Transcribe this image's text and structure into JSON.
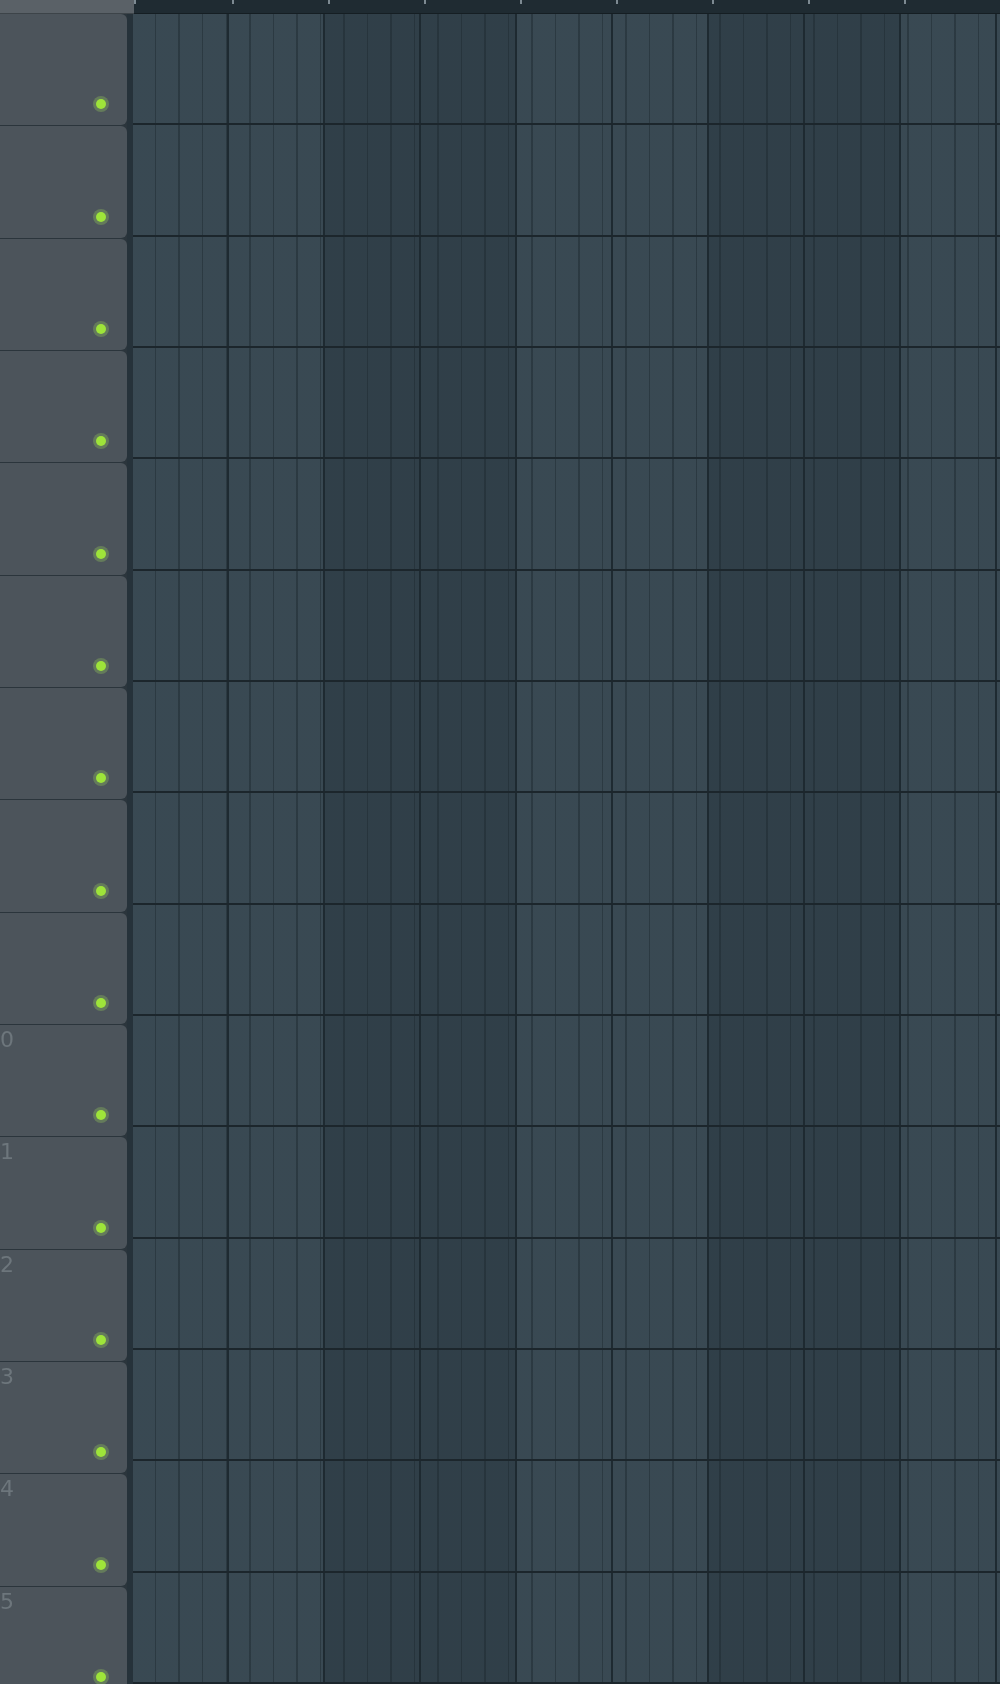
{
  "tracks": [
    {
      "on": true
    },
    {
      "on": true
    },
    {
      "on": true
    },
    {
      "on": true
    },
    {
      "on": true
    },
    {
      "on": true
    },
    {
      "on": true
    },
    {
      "on": true
    },
    {
      "on": true
    },
    {
      "label": "0",
      "on": true
    },
    {
      "label": "1",
      "on": true
    },
    {
      "label": "2",
      "on": true
    },
    {
      "label": "3",
      "on": true
    },
    {
      "label": "4",
      "on": true
    },
    {
      "label": "5",
      "on": true
    }
  ]
}
